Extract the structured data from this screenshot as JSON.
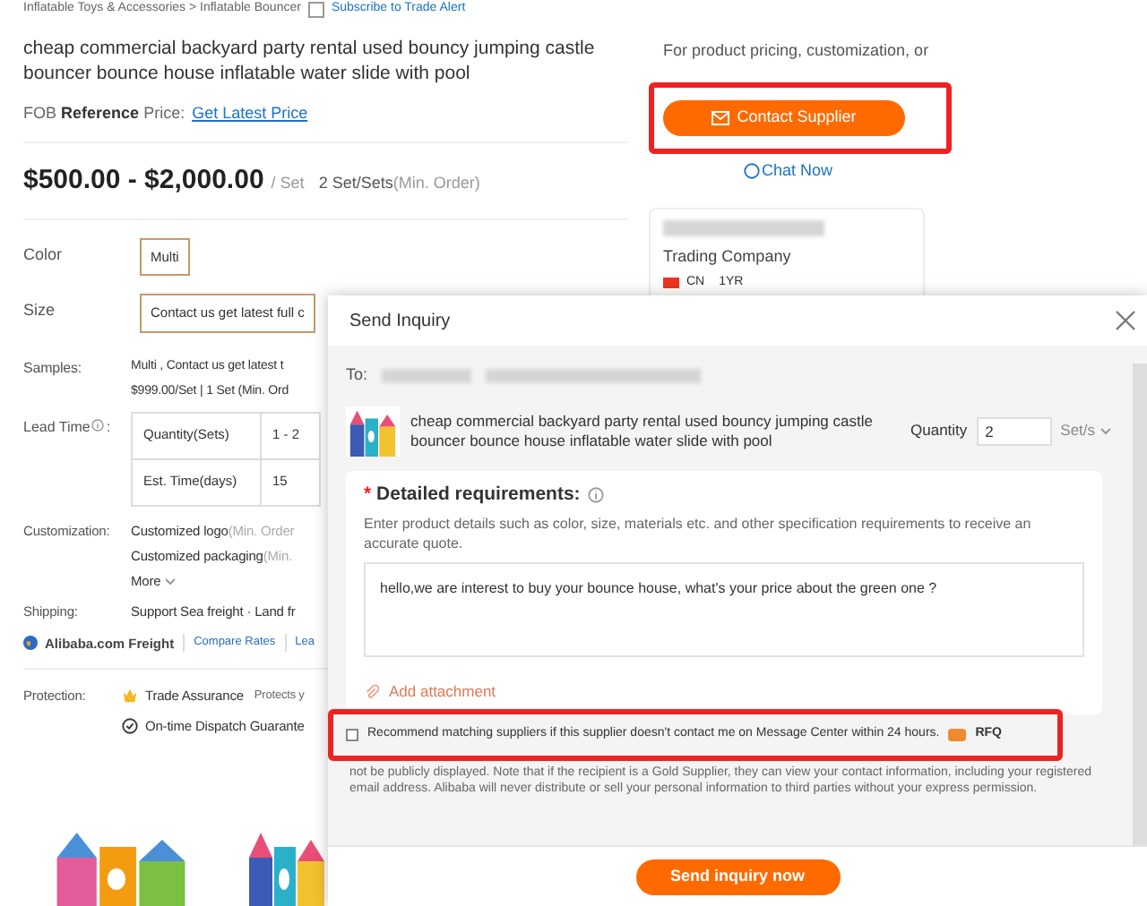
{
  "breadcrumb": {
    "path": "Inflatable Toys & Accessories  >  Inflatable Bouncer",
    "subscribe": "Subscribe to Trade Alert",
    "subscribed": false
  },
  "product": {
    "title": "cheap commercial backyard party rental used bouncy jumping castle bouncer bounce house inflatable water slide with pool",
    "fob_label": "FOB",
    "fob_bold": "Reference",
    "fob_rest": "Price:",
    "fob_link": "Get Latest Price",
    "price": "$500.00 - $2,000.00",
    "price_unit": "/ Set",
    "moq": "2 Set/Sets",
    "moq_note": "(Min. Order)"
  },
  "options": [
    {
      "label": "Color",
      "value": "Multi",
      "selected": true
    },
    {
      "label": "Size",
      "value": "Contact us get latest full c",
      "selected": true
    }
  ],
  "samples": {
    "label": "Samples:",
    "line1": "Multi , Contact us get latest t",
    "line2": "$999.00/Set | 1 Set (Min. Ord"
  },
  "lead_time": {
    "label": "Lead Time",
    "colon": ":",
    "rows": [
      [
        "Quantity(Sets)",
        "1 - 2"
      ],
      [
        "Est. Time(days)",
        "15"
      ]
    ]
  },
  "customization": {
    "label": "Customization:",
    "items": [
      {
        "name": "Customized logo",
        "note": "(Min. Order"
      },
      {
        "name": "Customized packaging",
        "note": "(Min."
      }
    ],
    "more": "More"
  },
  "shipping": {
    "label": "Shipping:",
    "value": "Support Sea freight · Land fr",
    "freight": "Alibaba.com Freight",
    "compare": "Compare Rates",
    "learn": "Lea"
  },
  "protection": {
    "label": "Protection:",
    "trade": "Trade Assurance",
    "trade_note": "Protects y",
    "dispatch": "On-time Dispatch Guarante"
  },
  "side": {
    "intro": "For product pricing, customization, or",
    "contact": "Contact Supplier",
    "chat": "Chat Now",
    "company_type": "Trading Company",
    "country": "CN",
    "years": "1YR"
  },
  "dialog": {
    "title": "Send Inquiry",
    "to": "To:",
    "product": "cheap commercial backyard party rental used bouncy jumping castle bouncer bounce house inflatable water slide with pool",
    "quantity_label": "Quantity",
    "quantity": "2",
    "unit": "Set/s",
    "req_mark": "*",
    "req_label": "Detailed requirements:",
    "req_hint": "Enter product details such as color, size, materials etc. and other specification requirements to receive an accurate quote.",
    "message": "hello,we are interest to buy your bounce house, what's your price about the green one ?",
    "attachment": "Add attachment",
    "recommend": {
      "text": "Recommend matching suppliers if this supplier doesn't contact me on Message Center within 24 hours.",
      "badge": "RFQ",
      "checked": false
    },
    "disclaimer": "not be publicly displayed. Note that if the recipient is a Gold Supplier, they can view your contact information, including your registered email address. Alibaba will never distribute or sell your personal information to third parties without your express permission.",
    "send": "Send inquiry now"
  }
}
